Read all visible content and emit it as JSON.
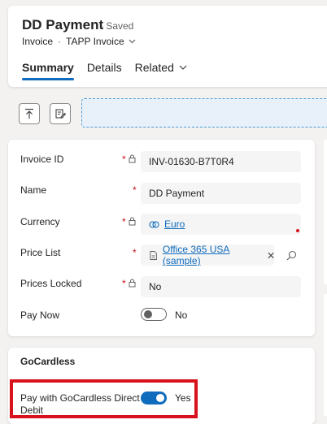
{
  "header": {
    "title": "DD Payment",
    "saved_status": "- Saved",
    "breadcrumb": {
      "entity": "Invoice",
      "form": "TAPP Invoice"
    },
    "tabs": [
      {
        "label": "Summary",
        "active": true
      },
      {
        "label": "Details",
        "active": false
      },
      {
        "label": "Related",
        "active": false
      }
    ]
  },
  "toolbar": {
    "icons": [
      "upload-icon",
      "edit-form-icon"
    ]
  },
  "form": {
    "fields": [
      {
        "label": "Invoice ID",
        "required": true,
        "locked": true,
        "value": "INV-01630-B7T0R4"
      },
      {
        "label": "Name",
        "required": true,
        "locked": false,
        "value": "DD Payment"
      },
      {
        "label": "Currency",
        "required": true,
        "locked": true,
        "value": "Euro"
      },
      {
        "label": "Price List",
        "required": true,
        "locked": false,
        "value": "Office 365 USA (sample)"
      },
      {
        "label": "Prices Locked",
        "required": true,
        "locked": true,
        "value": "No"
      },
      {
        "label": "Pay Now",
        "toggle": false,
        "value": "No"
      }
    ],
    "required_marker": "*"
  },
  "gocardless": {
    "section_title": "GoCardless",
    "field_label_line1": "Pay with GoCardless Direct",
    "field_label_line2": "Debit",
    "toggle": true,
    "value": "Yes"
  },
  "colors": {
    "accent": "#0f6cbd",
    "required": "#c50f1f",
    "highlight": "#d8121b"
  }
}
